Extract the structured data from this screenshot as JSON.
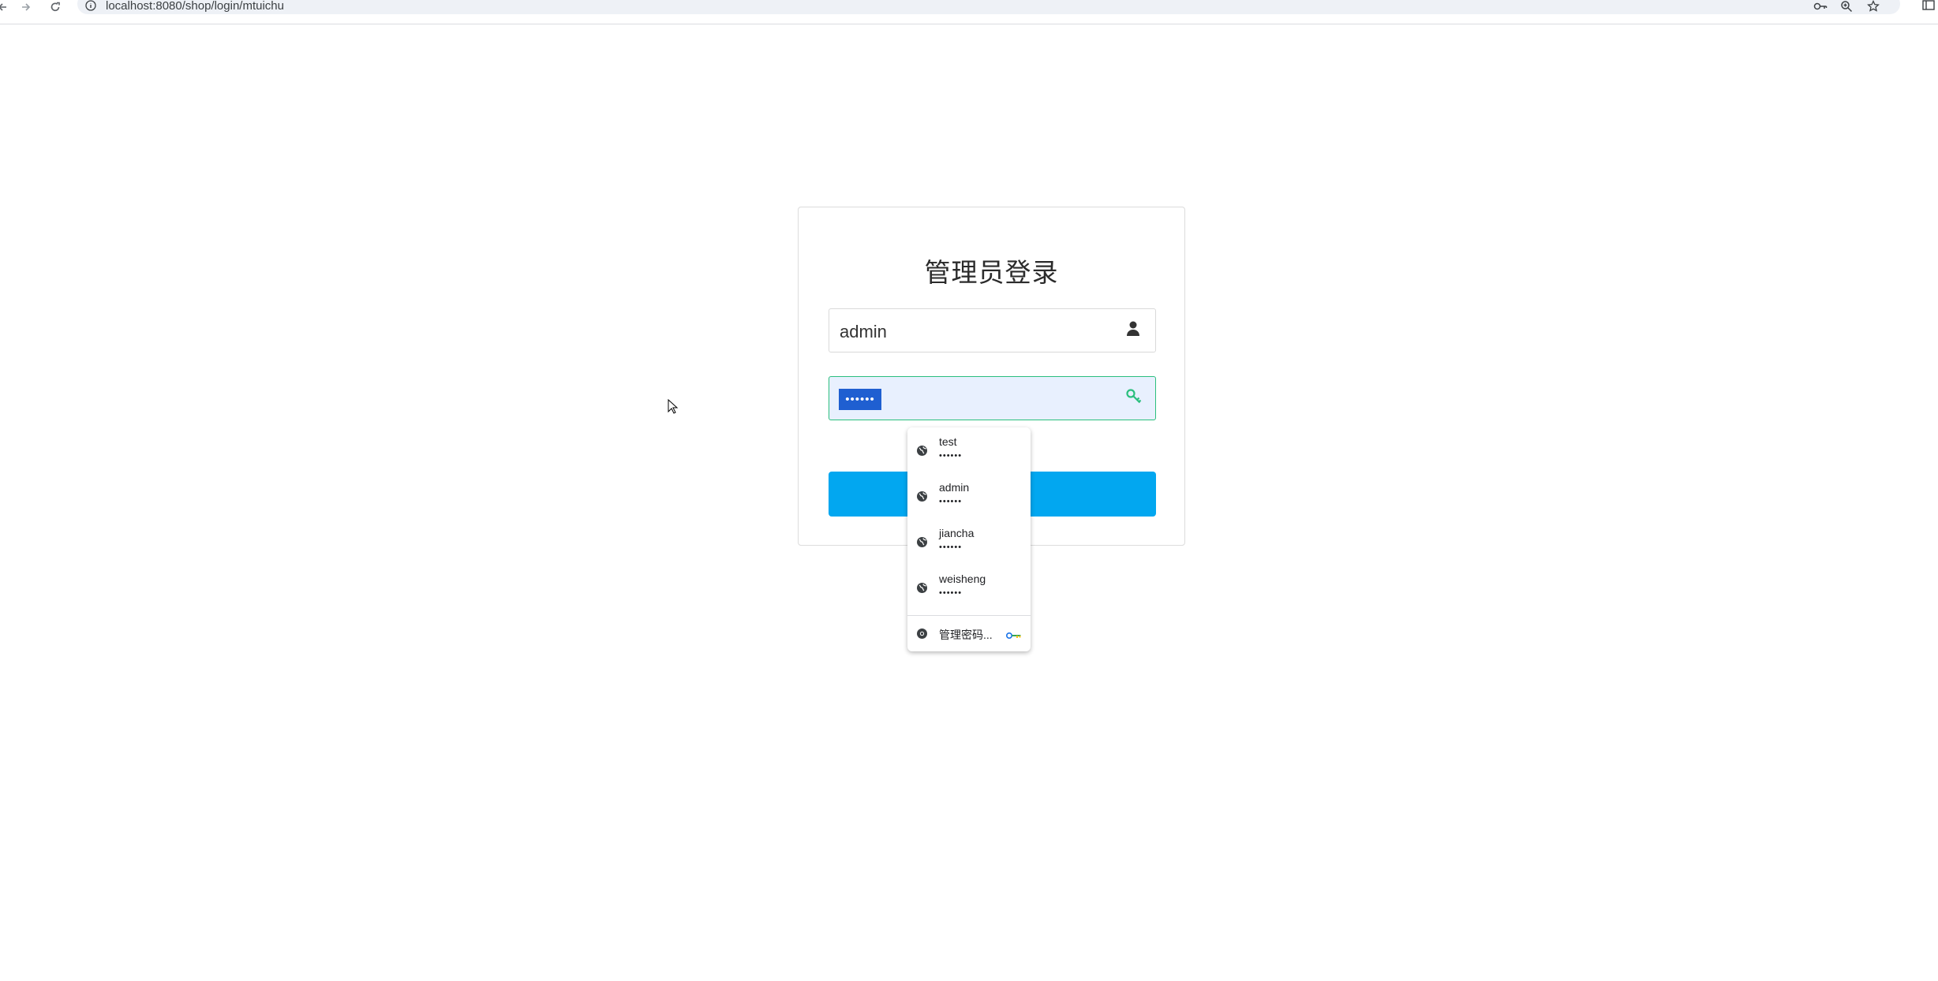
{
  "browser": {
    "url": "localhost:8080/shop/login/mtuichu"
  },
  "login": {
    "title": "管理员登录",
    "username_value": "admin",
    "password_mask": "••••••"
  },
  "autofill": {
    "suggestions": [
      {
        "username": "test",
        "password_mask": "••••••"
      },
      {
        "username": "admin",
        "password_mask": "••••••"
      },
      {
        "username": "jiancha",
        "password_mask": "••••••"
      },
      {
        "username": "weisheng",
        "password_mask": "••••••"
      }
    ],
    "manage_label": "管理密码..."
  },
  "colors": {
    "button_bg": "#02a7f0",
    "password_border": "#2bbf7e",
    "password_fill": "#e8f0fe",
    "selection": "#1f5fd1"
  },
  "icons": [
    "back-arrow-icon",
    "forward-arrow-icon",
    "reload-icon",
    "info-icon",
    "password-key-icon",
    "zoom-icon",
    "bookmark-star-icon",
    "side-panel-icon",
    "user-icon",
    "key-icon",
    "globe-icon",
    "chrome-icon"
  ]
}
